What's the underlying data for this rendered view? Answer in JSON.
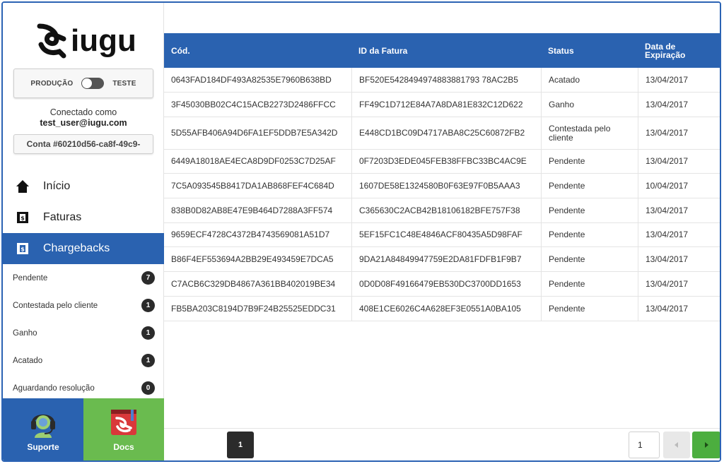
{
  "brand": {
    "name": "iugu"
  },
  "environment": {
    "production_label": "PRODUÇÃO",
    "test_label": "TESTE"
  },
  "connection": {
    "label": "Conectado como",
    "user": "test_user@iugu.com",
    "account": "Conta #60210d56-ca8f-49c9-"
  },
  "nav": {
    "inicio": "Início",
    "faturas": "Faturas",
    "chargebacks": "Chargebacks"
  },
  "subnav": [
    {
      "label": "Pendente",
      "count": "7"
    },
    {
      "label": "Contestada pelo cliente",
      "count": "1"
    },
    {
      "label": "Ganho",
      "count": "1"
    },
    {
      "label": "Acatado",
      "count": "1"
    },
    {
      "label": "Aguardando resolução",
      "count": "0"
    }
  ],
  "tiles": {
    "suporte": "Suporte",
    "docs": "Docs"
  },
  "table": {
    "headers": {
      "cod": "Cód.",
      "id": "ID da Fatura",
      "status": "Status",
      "data": "Data de Expiração"
    },
    "rows": [
      {
        "cod": "0643FAD184DF493A82535E7960B638BD",
        "id": "BF520E5428494974883881793 78AC2B5",
        "status": "Acatado",
        "data": "13/04/2017"
      },
      {
        "cod": "3F45030BB02C4C15ACB2273D2486FFCC",
        "id": "FF49C1D712E84A7A8DA81E832C12D622",
        "status": "Ganho",
        "data": "13/04/2017"
      },
      {
        "cod": "5D55AFB406A94D6FA1EF5DDB7E5A342D",
        "id": "E448CD1BC09D4717ABA8C25C60872FB2",
        "status": "Contestada pelo cliente",
        "data": "13/04/2017"
      },
      {
        "cod": "6449A18018AE4ECA8D9DF0253C7D25AF",
        "id": "0F7203D3EDE045FEB38FFBC33BC4AC9E",
        "status": "Pendente",
        "data": "13/04/2017"
      },
      {
        "cod": "7C5A093545B8417DA1AB868FEF4C684D",
        "id": "1607DE58E1324580B0F63E97F0B5AAA3",
        "status": "Pendente",
        "data": "10/04/2017"
      },
      {
        "cod": "838B0D82AB8E47E9B464D7288A3FF574",
        "id": "C365630C2ACB42B18106182BFE757F38",
        "status": "Pendente",
        "data": "13/04/2017"
      },
      {
        "cod": "9659ECF4728C4372B4743569081A51D7",
        "id": "5EF15FC1C48E4846ACF80435A5D98FAF",
        "status": "Pendente",
        "data": "13/04/2017"
      },
      {
        "cod": "B86F4EF553694A2BB29E493459E7DCA5",
        "id": "9DA21A84849947759E2DA81FDFB1F9B7",
        "status": "Pendente",
        "data": "13/04/2017"
      },
      {
        "cod": "C7ACB6C329DB4867A361BB402019BE34",
        "id": "0D0D08F49166479EB530DC3700DD1653",
        "status": "Pendente",
        "data": "13/04/2017"
      },
      {
        "cod": "FB5BA203C8194D7B9F24B25525EDDC31",
        "id": "408E1CE6026C4A628EF3E0551A0BA105",
        "status": "Pendente",
        "data": "13/04/2017"
      }
    ]
  },
  "pagination": {
    "current": "1",
    "input_value": "1"
  },
  "colors": {
    "primary": "#2a62b0",
    "docs": "#6abb4f",
    "next": "#4cae3f",
    "badge": "#2b2b2b"
  }
}
